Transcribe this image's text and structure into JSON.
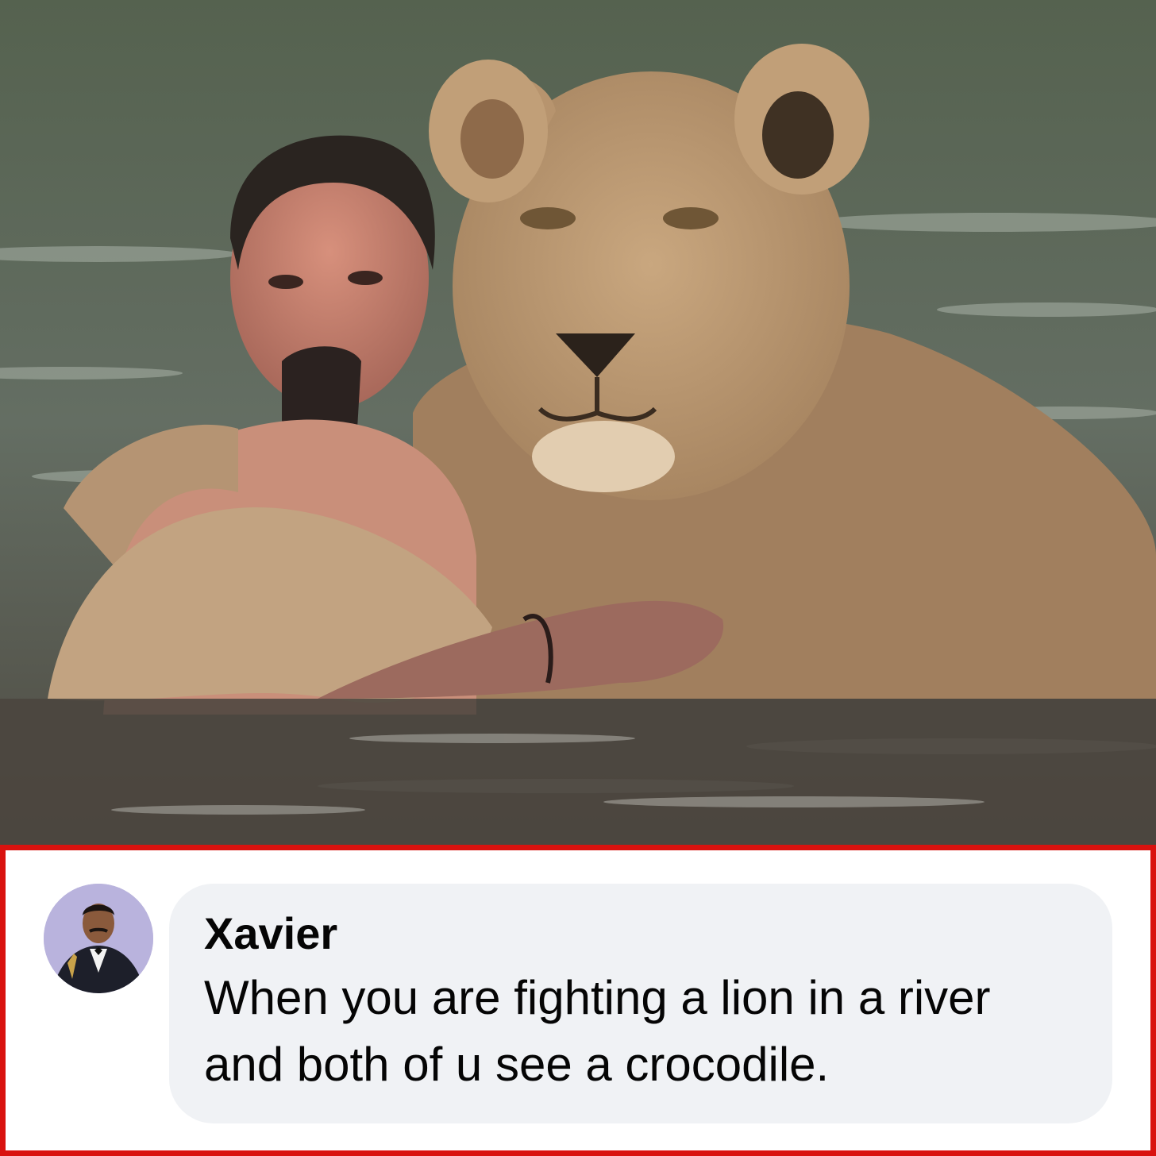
{
  "post": {
    "image_alt": "Man in a river hugging a lioness"
  },
  "comment": {
    "author": "Xavier",
    "text": "When you are fighting a lion in a river and both of u see a crocodile.",
    "avatar_icon": "user-avatar-icon"
  },
  "colors": {
    "highlight_border": "#d9120f",
    "bubble_background": "#f0f2f5",
    "text": "#050505"
  }
}
